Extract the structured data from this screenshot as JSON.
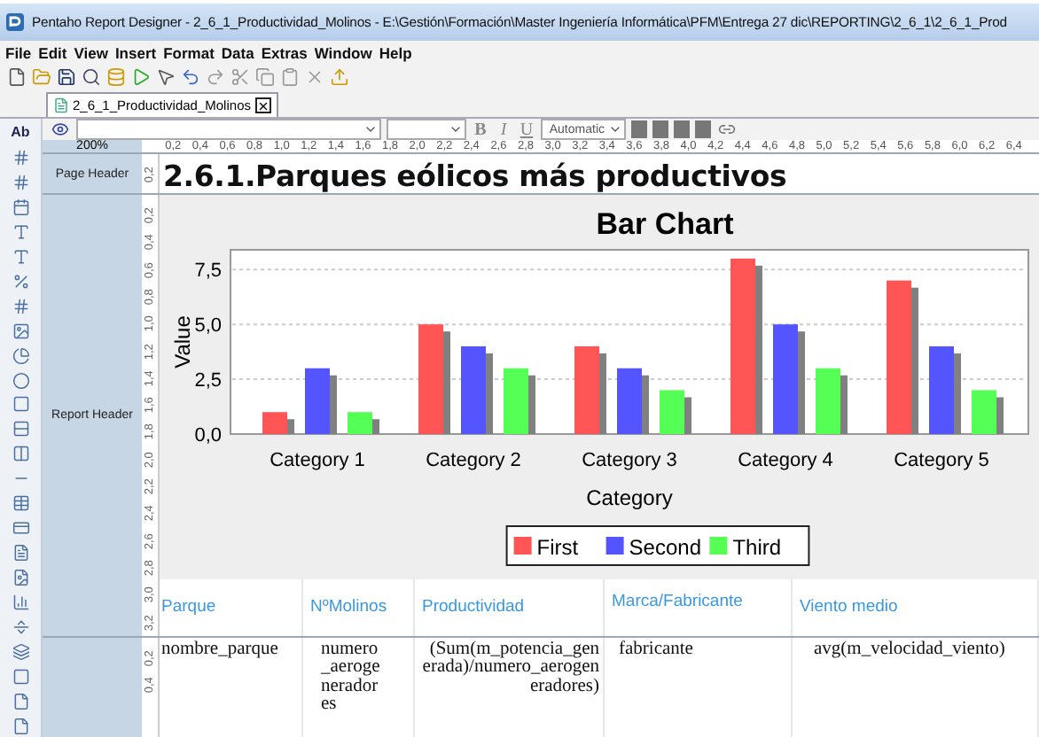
{
  "window": {
    "title": "Pentaho Report Designer - 2_6_1_Productividad_Molinos - E:\\Gestión\\Formación\\Master Ingeniería Informática\\PFM\\Entrega 27 dic\\REPORTING\\2_6_1\\2_6_1_Prod"
  },
  "menu": [
    "File",
    "Edit",
    "View",
    "Insert",
    "Format",
    "Data",
    "Extras",
    "Window",
    "Help"
  ],
  "tabs": [
    {
      "label": "2_6_1_Productividad_Molinos",
      "selected": true
    }
  ],
  "palette": {
    "label_tool": "Ab"
  },
  "format_bar": {
    "style_buttons": [
      "B",
      "I",
      "U"
    ],
    "color_dropdown": "Automatic"
  },
  "zoom": "200%",
  "ruler": [
    "0,2",
    "0,4",
    "0,6",
    "0,8",
    "1,0",
    "1,2",
    "1,4",
    "1,6",
    "1,8",
    "2,0",
    "2,2",
    "2,4",
    "2,6",
    "2,8",
    "3,0",
    "3,2",
    "3,4",
    "3,6",
    "3,8",
    "4,0",
    "4,2",
    "4,4",
    "4,6",
    "4,8",
    "5,0",
    "5,2",
    "5,4",
    "5,6",
    "5,8",
    "6,0",
    "6,2",
    "6,4"
  ],
  "bands": [
    {
      "kind": "page_header",
      "label": "Page Header",
      "ruler": [
        "0,2"
      ],
      "title": "2.6.1.Parques eólicos más productivos"
    },
    {
      "kind": "report_header",
      "label": "Report Header",
      "ruler": [
        "0,2",
        "0,4",
        "0,6",
        "0,8",
        "1,0",
        "1,2",
        "1,4",
        "1,6",
        "1,8",
        "2,0",
        "2,2",
        "2,4",
        "2,6",
        "2,8",
        "3,0",
        "3,2"
      ],
      "chart_data": {
        "type": "bar",
        "title": "Bar Chart",
        "xlabel": "Category",
        "ylabel": "Value",
        "categories": [
          "Category 1",
          "Category 2",
          "Category 3",
          "Category 4",
          "Category 5"
        ],
        "ylim": [
          0,
          8.4
        ],
        "grid": true,
        "legend": true,
        "yticks": [
          {
            "value": 0,
            "label": "0,0"
          },
          {
            "value": 2.5,
            "label": "2,5"
          },
          {
            "value": 5,
            "label": "5,0"
          },
          {
            "value": 7.5,
            "label": "7,5"
          }
        ],
        "series": [
          {
            "name": "First",
            "color": "#ff5555",
            "values": [
              1,
              5,
              4,
              8,
              7
            ]
          },
          {
            "name": "Second",
            "color": "#5555ff",
            "values": [
              3,
              4,
              3,
              5,
              4
            ]
          },
          {
            "name": "Third",
            "color": "#55ff55",
            "values": [
              1,
              3,
              2,
              3,
              2
            ]
          }
        ]
      },
      "columns": [
        "Parque",
        "NºMolinos",
        "Productividad",
        "Marca/Fabricante",
        "Viento medio"
      ]
    },
    {
      "kind": "details",
      "ruler": [
        "0,2",
        "0,4"
      ],
      "cells": [
        "nombre_parque",
        "numero_aerogeneradores",
        "(Sum(m_potencia_generada)/numero_aerogeneradores)",
        "fabricante",
        "avg(m_velocidad_viento)"
      ]
    }
  ]
}
